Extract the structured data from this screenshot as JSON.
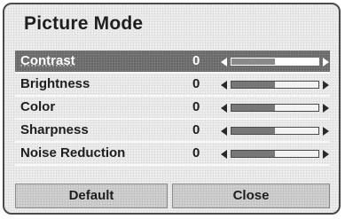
{
  "dialog": {
    "title": "Picture Mode"
  },
  "settings": [
    {
      "label": "Contrast",
      "value": "0",
      "level": 0.5,
      "selected": true
    },
    {
      "label": "Brightness",
      "value": "0",
      "level": 0.5,
      "selected": false
    },
    {
      "label": "Color",
      "value": "0",
      "level": 0.5,
      "selected": false
    },
    {
      "label": "Sharpness",
      "value": "0",
      "level": 0.5,
      "selected": false
    },
    {
      "label": "Noise Reduction",
      "value": "0",
      "level": 0.5,
      "selected": false
    }
  ],
  "buttons": {
    "default_label": "Default",
    "close_label": "Close"
  },
  "colors": {
    "selected_row": "#6a6a6a",
    "panel": "#ececec",
    "text": "#1e1e1e"
  },
  "icons": [
    "arrow-left-icon",
    "arrow-right-icon"
  ]
}
